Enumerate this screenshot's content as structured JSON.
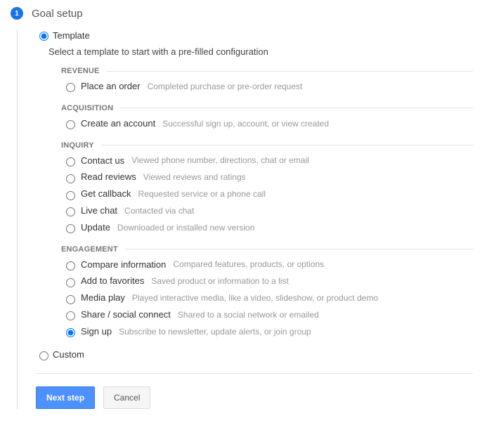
{
  "step": {
    "number": "1",
    "title": "Goal setup"
  },
  "options": {
    "template_label": "Template",
    "custom_label": "Custom"
  },
  "intro": "Select a template to start with a pre-filled configuration",
  "categories": [
    {
      "name": "REVENUE",
      "goals": [
        {
          "label": "Place an order",
          "desc": "Completed purchase or pre-order request",
          "selected": false
        }
      ]
    },
    {
      "name": "ACQUISITION",
      "goals": [
        {
          "label": "Create an account",
          "desc": "Successful sign up, account, or view created",
          "selected": false
        }
      ]
    },
    {
      "name": "INQUIRY",
      "goals": [
        {
          "label": "Contact us",
          "desc": "Viewed phone number, directions, chat or email",
          "selected": false
        },
        {
          "label": "Read reviews",
          "desc": "Viewed reviews and ratings",
          "selected": false
        },
        {
          "label": "Get callback",
          "desc": "Requested service or a phone call",
          "selected": false
        },
        {
          "label": "Live chat",
          "desc": "Contacted via chat",
          "selected": false
        },
        {
          "label": "Update",
          "desc": "Downloaded or installed new version",
          "selected": false
        }
      ]
    },
    {
      "name": "ENGAGEMENT",
      "goals": [
        {
          "label": "Compare information",
          "desc": "Compared features, products, or options",
          "selected": false
        },
        {
          "label": "Add to favorites",
          "desc": "Saved product or information to a list",
          "selected": false
        },
        {
          "label": "Media play",
          "desc": "Played interactive media, like a video, slideshow, or product demo",
          "selected": false
        },
        {
          "label": "Share / social connect",
          "desc": "Shared to a social network or emailed",
          "selected": false
        },
        {
          "label": "Sign up",
          "desc": "Subscribe to newsletter, update alerts, or join group",
          "selected": true
        }
      ]
    }
  ],
  "buttons": {
    "next": "Next step",
    "cancel": "Cancel"
  }
}
